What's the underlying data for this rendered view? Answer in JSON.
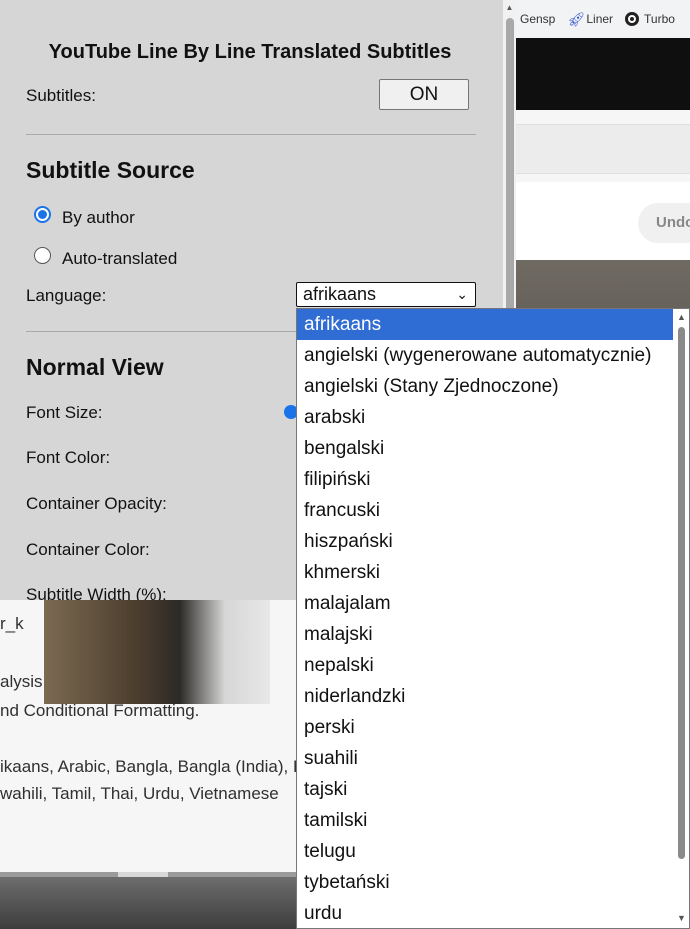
{
  "bookmarks": [
    {
      "label": "Gensp",
      "icon": "genspark-icon"
    },
    {
      "label": "Liner",
      "icon": "rocket-icon"
    },
    {
      "label": "Turbo",
      "icon": "turbo-icon"
    }
  ],
  "background": {
    "undo_label": "Undo",
    "description_lines": [
      "r_k",
      "alysis,",
      "nd Conditional Formatting.",
      "ikaans, Arabic, Bangla, Bangla (India), E",
      "wahili, Tamil, Thai, Urdu, Vietnamese"
    ]
  },
  "popup": {
    "title": "YouTube Line By Line Translated Subtitles",
    "subtitles_label": "Subtitles:",
    "subtitles_toggle": "ON",
    "subtitle_source_title": "Subtitle Source",
    "source_options": [
      {
        "label": "By author",
        "checked": true
      },
      {
        "label": "Auto-translated",
        "checked": false
      }
    ],
    "language_label": "Language:",
    "language_selected": "afrikaans",
    "normal_view_title": "Normal View",
    "font_size_label": "Font Size:",
    "font_color_label": "Font Color:",
    "container_opacity_label": "Container Opacity:",
    "container_color_label": "Container Color:",
    "subtitle_width_label": "Subtitle Width (%):"
  },
  "dropdown": {
    "selected_index": 0,
    "options": [
      "afrikaans",
      "angielski (wygenerowane automatycznie)",
      "angielski (Stany Zjednoczone)",
      "arabski",
      "bengalski",
      "filipiński",
      "francuski",
      "hiszpański",
      "khmerski",
      "malajalam",
      "malajski",
      "nepalski",
      "niderlandzki",
      "perski",
      "suahili",
      "tajski",
      "tamilski",
      "telugu",
      "tybetański",
      "urdu"
    ]
  },
  "colors": {
    "accent": "#1a73e8",
    "selected_option_bg": "#2f6cd3",
    "popup_bg": "#d6d6d6"
  }
}
